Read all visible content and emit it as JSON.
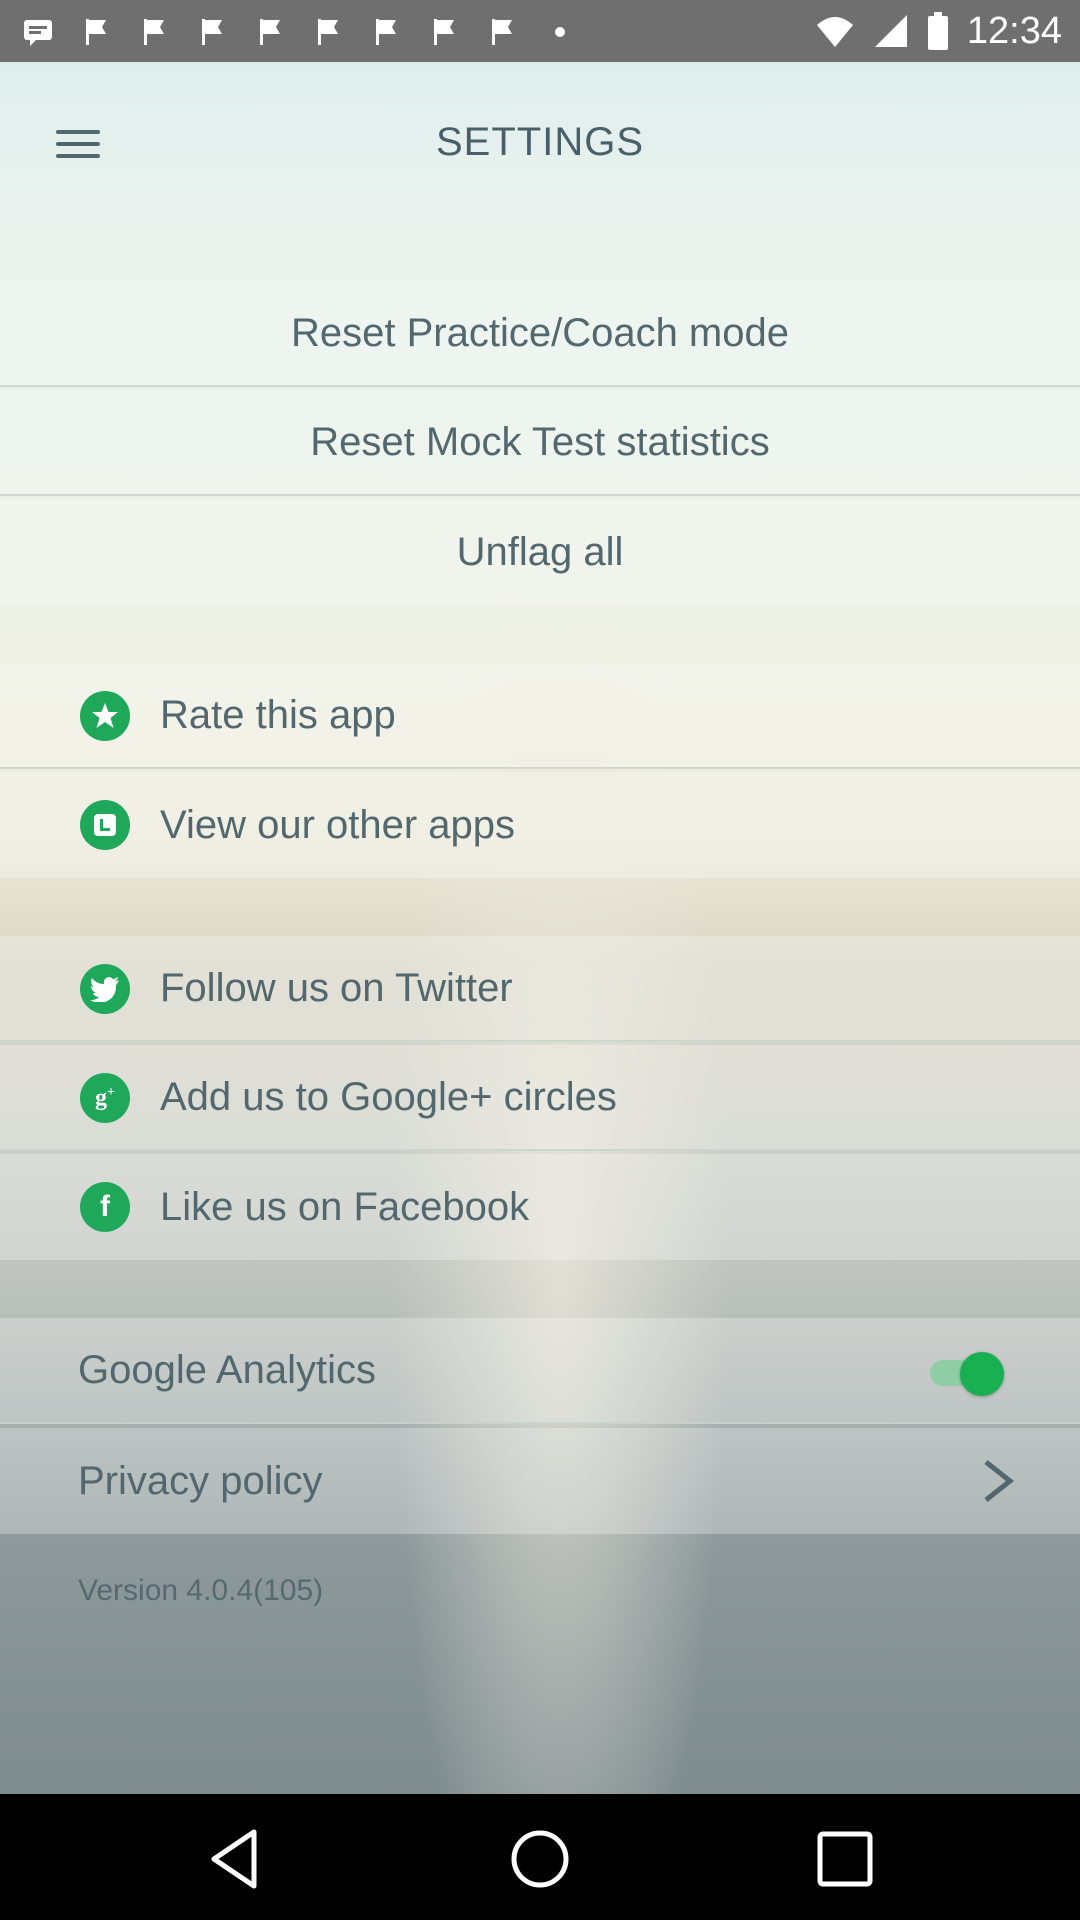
{
  "status_bar": {
    "time": "12:34",
    "left_icons": [
      "message-icon",
      "flag-icon",
      "flag-icon",
      "flag-icon",
      "flag-icon",
      "flag-icon",
      "flag-icon",
      "flag-icon",
      "flag-icon",
      "dot-icon"
    ],
    "right_icons": [
      "wifi-icon",
      "signal-icon",
      "battery-icon"
    ]
  },
  "header": {
    "title": "SETTINGS",
    "menu_icon": "hamburger-menu-icon"
  },
  "reset_section": {
    "items": [
      {
        "label": "Reset Practice/Coach mode"
      },
      {
        "label": "Reset Mock Test statistics"
      },
      {
        "label": "Unflag all"
      }
    ]
  },
  "app_section": {
    "items": [
      {
        "label": "Rate this app",
        "icon": "star-icon"
      },
      {
        "label": "View our other apps",
        "icon": "apps-icon"
      }
    ]
  },
  "social_section": {
    "items": [
      {
        "label": "Follow us on Twitter",
        "icon": "twitter-icon"
      },
      {
        "label": "Add us to Google+ circles",
        "icon": "google-plus-icon"
      },
      {
        "label": "Like us on Facebook",
        "icon": "facebook-icon"
      }
    ]
  },
  "prefs_section": {
    "analytics_label": "Google Analytics",
    "analytics_enabled": true,
    "privacy_label": "Privacy policy"
  },
  "version": "Version 4.0.4(105)",
  "colors": {
    "accent": "#1fa85a",
    "text": "#53676e"
  },
  "nav_bar": {
    "buttons": [
      "back-icon",
      "home-icon",
      "recents-icon"
    ]
  }
}
